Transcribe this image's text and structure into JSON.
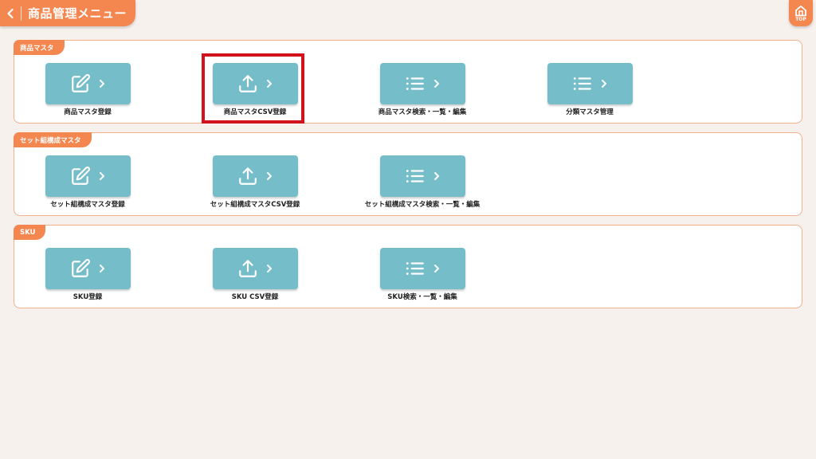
{
  "header": {
    "title": "商品管理メニュー",
    "top_label": "TOP"
  },
  "sections": [
    {
      "tag": "商品マスタ",
      "items": [
        {
          "label": "商品マスタ登録",
          "icon": "edit-icon"
        },
        {
          "label": "商品マスタCSV登録",
          "icon": "upload-icon"
        },
        {
          "label": "商品マスタ検索・一覧・編集",
          "icon": "list-icon"
        },
        {
          "label": "分類マスタ管理",
          "icon": "list-icon"
        }
      ]
    },
    {
      "tag": "セット組構成マスタ",
      "items": [
        {
          "label": "セット組構成マスタ登録",
          "icon": "edit-icon"
        },
        {
          "label": "セット組構成マスタCSV登録",
          "icon": "upload-icon"
        },
        {
          "label": "セット組構成マスタ検索・一覧・編集",
          "icon": "list-icon"
        }
      ]
    },
    {
      "tag": "SKU",
      "items": [
        {
          "label": "SKU登録",
          "icon": "edit-icon"
        },
        {
          "label": "SKU CSV登録",
          "icon": "upload-icon"
        },
        {
          "label": "SKU検索・一覧・編集",
          "icon": "list-icon"
        }
      ]
    }
  ],
  "colors": {
    "accent": "#f4864f",
    "button": "#74bdc9",
    "highlight": "#d2131b",
    "background": "#f7f1ed"
  }
}
